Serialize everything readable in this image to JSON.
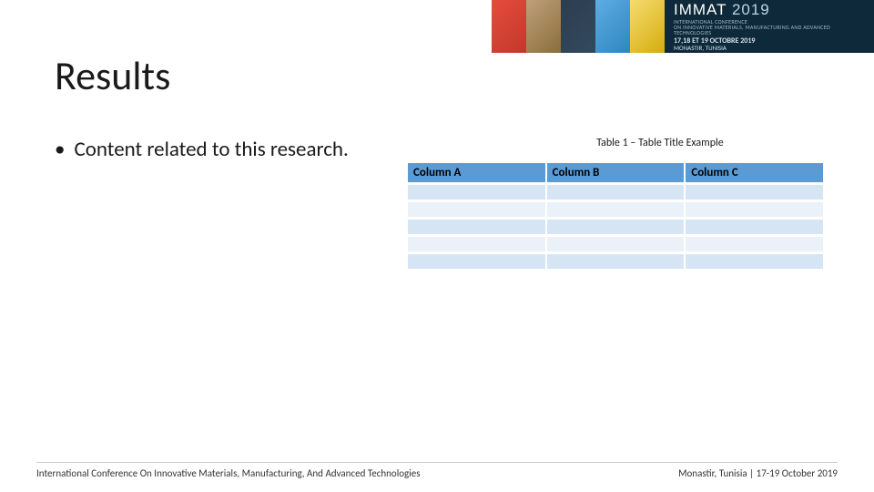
{
  "banner": {
    "brand_name": "IMMAT",
    "brand_year": "2019",
    "subtitle_line1": "INTERNATIONAL CONFERENCE",
    "subtitle_line2": "ON INNOVATIVE MATERIALS, MANUFACTURING AND ADVANCED TECHNOLOGIES",
    "date_line": "17,18 ET 19 OCTOBRE 2019",
    "location_line": "MONASTIR, TUNISIA"
  },
  "title": "Results",
  "bullet_text": "Content related to this research.",
  "table": {
    "caption": "Table 1 – Table Title Example",
    "headers": [
      "Column A",
      "Column B",
      "Column C"
    ],
    "rows": [
      [
        "",
        "",
        ""
      ],
      [
        "",
        "",
        ""
      ],
      [
        "",
        "",
        ""
      ],
      [
        "",
        "",
        ""
      ],
      [
        "",
        "",
        ""
      ]
    ]
  },
  "footer": {
    "left": "International Conference On Innovative Materials, Manufacturing, And Advanced Technologies",
    "right": "Monastir, Tunisia | 17-19 October 2019"
  }
}
